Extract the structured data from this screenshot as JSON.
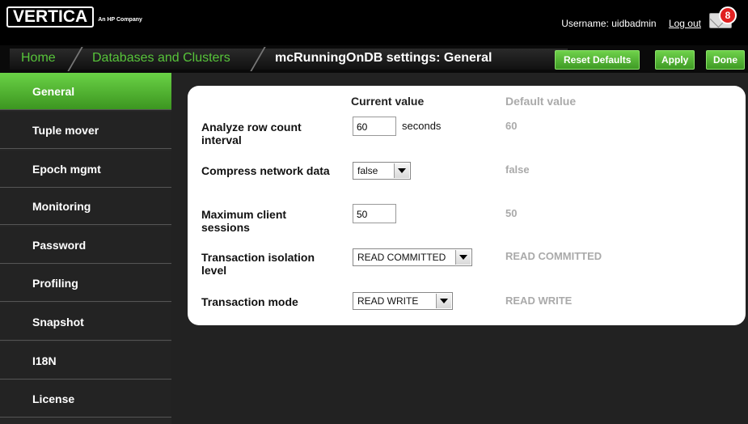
{
  "header": {
    "logo_text": "VERTICA",
    "logo_subtext": "An HP Company",
    "username_text": "Username: uidbadmin",
    "logout_label": "Log out",
    "message_count": "8"
  },
  "breadcrumb": {
    "home": "Home",
    "databases": "Databases and Clusters",
    "title": "mcRunningOnDB settings: General"
  },
  "actions": {
    "reset_defaults": "Reset Defaults",
    "apply": "Apply",
    "done": "Done"
  },
  "sidebar": {
    "items": [
      {
        "label": "General"
      },
      {
        "label": "Tuple mover"
      },
      {
        "label": "Epoch mgmt"
      },
      {
        "label": "Monitoring"
      },
      {
        "label": "Password"
      },
      {
        "label": "Profiling"
      },
      {
        "label": "Snapshot"
      },
      {
        "label": "I18N"
      },
      {
        "label": "License"
      }
    ]
  },
  "settings": {
    "current_header": "Current value",
    "default_header": "Default value",
    "rows": [
      {
        "label": "Analyze row count interval",
        "value": "60",
        "unit": "seconds",
        "default": "60"
      },
      {
        "label": "Compress network data",
        "value": "false",
        "default": "false"
      },
      {
        "label": "Maximum client sessions",
        "value": "50",
        "default": "50"
      },
      {
        "label": "Transaction isolation level",
        "value": "READ COMMITTED",
        "default": "READ COMMITTED"
      },
      {
        "label": "Transaction mode",
        "value": "READ WRITE",
        "default": "READ WRITE"
      }
    ]
  },
  "colors": {
    "accent_green": "#57c43a",
    "topbar": "#000000",
    "sidebar": "#262626",
    "default_text": "#aaaaaa"
  }
}
